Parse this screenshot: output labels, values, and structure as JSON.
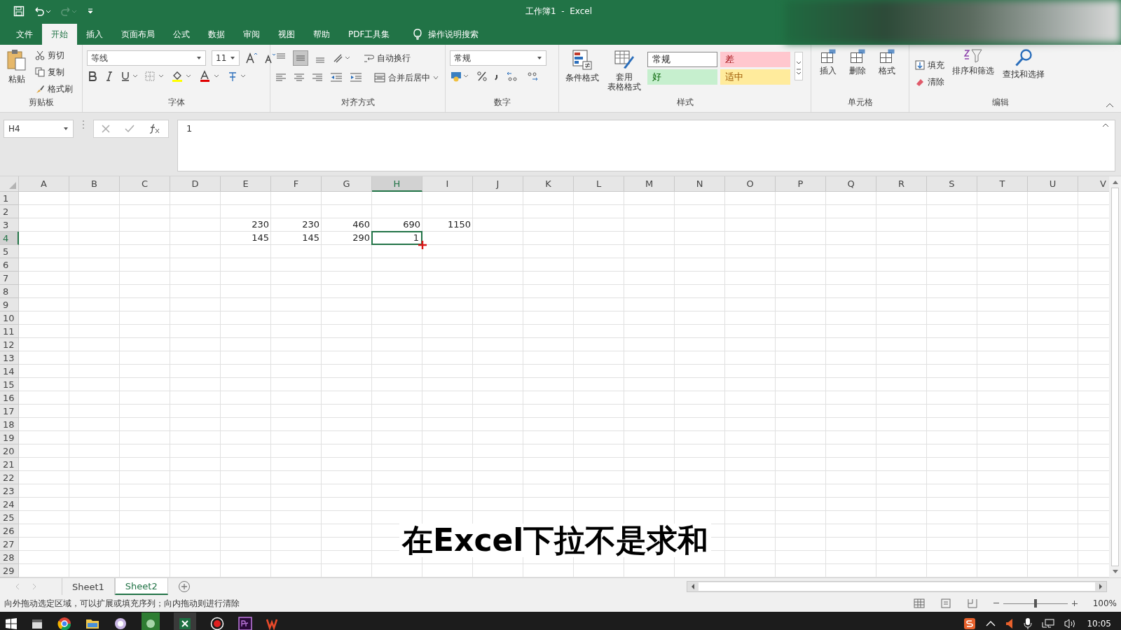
{
  "window": {
    "title": "工作簿1  -  Excel"
  },
  "ribbon_tabs": [
    {
      "label": "文件",
      "selected": false
    },
    {
      "label": "开始",
      "selected": true
    },
    {
      "label": "插入",
      "selected": false
    },
    {
      "label": "页面布局",
      "selected": false
    },
    {
      "label": "公式",
      "selected": false
    },
    {
      "label": "数据",
      "selected": false
    },
    {
      "label": "审阅",
      "selected": false
    },
    {
      "label": "视图",
      "selected": false
    },
    {
      "label": "帮助",
      "selected": false
    },
    {
      "label": "PDF工具集",
      "selected": false
    }
  ],
  "search_hint": "操作说明搜索",
  "clipboard": {
    "label": "剪贴板",
    "paste": "粘贴",
    "cut": "剪切",
    "copy": "复制",
    "painter": "格式刷"
  },
  "font": {
    "label": "字体",
    "name": "等线",
    "size": "11"
  },
  "alignment": {
    "label": "对齐方式",
    "wrap": "自动换行",
    "merge": "合并后居中"
  },
  "number": {
    "label": "数字",
    "format": "常规"
  },
  "styles": {
    "label": "样式",
    "conditional": "条件格式",
    "table_lines": [
      "套用",
      "表格格式"
    ],
    "cell_styles": [
      {
        "label": "常规",
        "kind": "normal"
      },
      {
        "label": "差",
        "kind": "bad"
      },
      {
        "label": "好",
        "kind": "good"
      },
      {
        "label": "适中",
        "kind": "neutral"
      }
    ]
  },
  "cells": {
    "label": "单元格",
    "buttons": [
      "插入",
      "删除",
      "格式"
    ]
  },
  "editing": {
    "label": "编辑",
    "fill": "填充",
    "clear": "清除",
    "sort": "排序和筛选",
    "find": "查找和选择"
  },
  "formula_bar": {
    "name_box": "H4",
    "value": "1"
  },
  "columns": [
    {
      "label": "A",
      "selected": false
    },
    {
      "label": "B",
      "selected": false
    },
    {
      "label": "C",
      "selected": false
    },
    {
      "label": "D",
      "selected": false
    },
    {
      "label": "E",
      "selected": false
    },
    {
      "label": "F",
      "selected": false
    },
    {
      "label": "G",
      "selected": false
    },
    {
      "label": "H",
      "selected": true
    },
    {
      "label": "I",
      "selected": false
    },
    {
      "label": "J",
      "selected": false
    },
    {
      "label": "K",
      "selected": false
    },
    {
      "label": "L",
      "selected": false
    },
    {
      "label": "M",
      "selected": false
    },
    {
      "label": "N",
      "selected": false
    },
    {
      "label": "O",
      "selected": false
    },
    {
      "label": "P",
      "selected": false
    },
    {
      "label": "Q",
      "selected": false
    },
    {
      "label": "R",
      "selected": false
    },
    {
      "label": "S",
      "selected": false
    },
    {
      "label": "T",
      "selected": false
    },
    {
      "label": "U",
      "selected": false
    },
    {
      "label": "V",
      "selected": false
    }
  ],
  "rows": [
    {
      "label": "1",
      "selected": false
    },
    {
      "label": "2",
      "selected": false
    },
    {
      "label": "3",
      "selected": false
    },
    {
      "label": "4",
      "selected": true
    },
    {
      "label": "5",
      "selected": false
    },
    {
      "label": "6",
      "selected": false
    },
    {
      "label": "7",
      "selected": false
    },
    {
      "label": "8",
      "selected": false
    },
    {
      "label": "9",
      "selected": false
    },
    {
      "label": "10",
      "selected": false
    },
    {
      "label": "11",
      "selected": false
    },
    {
      "label": "12",
      "selected": false
    },
    {
      "label": "13",
      "selected": false
    },
    {
      "label": "14",
      "selected": false
    },
    {
      "label": "15",
      "selected": false
    },
    {
      "label": "16",
      "selected": false
    },
    {
      "label": "17",
      "selected": false
    },
    {
      "label": "18",
      "selected": false
    },
    {
      "label": "19",
      "selected": false
    },
    {
      "label": "20",
      "selected": false
    },
    {
      "label": "21",
      "selected": false
    },
    {
      "label": "22",
      "selected": false
    },
    {
      "label": "23",
      "selected": false
    },
    {
      "label": "24",
      "selected": false
    },
    {
      "label": "25",
      "selected": false
    },
    {
      "label": "26",
      "selected": false
    },
    {
      "label": "27",
      "selected": false
    },
    {
      "label": "28",
      "selected": false
    },
    {
      "label": "29",
      "selected": false
    }
  ],
  "data_block": [
    [
      {
        "text": "230",
        "selected": false
      },
      {
        "text": "230",
        "selected": false
      },
      {
        "text": "460",
        "selected": false
      },
      {
        "text": "690",
        "selected": false
      },
      {
        "text": "1150",
        "selected": false
      }
    ],
    [
      {
        "text": "145",
        "selected": false
      },
      {
        "text": "145",
        "selected": false
      },
      {
        "text": "290",
        "selected": false
      },
      {
        "text": "1",
        "selected": true
      }
    ]
  ],
  "sheet_tabs": [
    {
      "label": "Sheet1",
      "selected": false
    },
    {
      "label": "Sheet2",
      "selected": true
    }
  ],
  "status_text": "向外拖动选定区域，可以扩展或填充序列；向内拖动则进行清除",
  "zoom": "100%",
  "zoom_slider": {
    "level": 0.5
  },
  "clock": "10:05",
  "caption": "在Excel下拉不是求和"
}
